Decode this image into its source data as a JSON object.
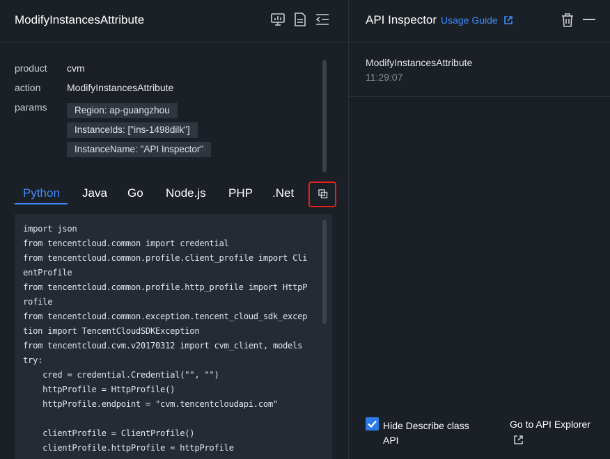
{
  "left_panel": {
    "title": "ModifyInstancesAttribute",
    "header_icons": [
      "monitor-chart-icon",
      "document-icon",
      "collapse-panel-icon"
    ],
    "fields": {
      "product_label": "product",
      "product_value": "cvm",
      "action_label": "action",
      "action_value": "ModifyInstancesAttribute",
      "params_label": "params",
      "params": [
        "Region: ap-guangzhou",
        "InstanceIds: [\"ins-1498dilk\"]",
        "InstanceName: \"API Inspector\""
      ]
    },
    "tabs": [
      "Python",
      "Java",
      "Go",
      "Node.js",
      "PHP",
      ".Net"
    ],
    "active_tab": "Python",
    "copy_icon": "copy-icon",
    "code_lines": [
      "import json",
      "from tencentcloud.common import credential",
      "from tencentcloud.common.profile.client_profile import Cli",
      "entProfile",
      "from tencentcloud.common.profile.http_profile import HttpP",
      "rofile",
      "from tencentcloud.common.exception.tencent_cloud_sdk_excep",
      "tion import TencentCloudSDKException",
      "from tencentcloud.cvm.v20170312 import cvm_client, models",
      "try:",
      "    cred = credential.Credential(\"\", \"\")",
      "    httpProfile = HttpProfile()",
      "    httpProfile.endpoint = \"cvm.tencentcloudapi.com\"",
      "",
      "    clientProfile = ClientProfile()",
      "    clientProfile.httpProfile = httpProfile"
    ]
  },
  "right_panel": {
    "title": "API Inspector",
    "usage_guide": "Usage Guide",
    "entry": {
      "name": "ModifyInstancesAttribute",
      "time": "11:29:07"
    },
    "hide_describe_label": "Hide Describe class API",
    "hide_describe_checked": true,
    "explorer_link": "Go to API Explorer"
  },
  "colors": {
    "background": "#1b1f26",
    "accent": "#3d8bfd",
    "highlight_border": "#e5201f",
    "code_background": "#252b34"
  }
}
